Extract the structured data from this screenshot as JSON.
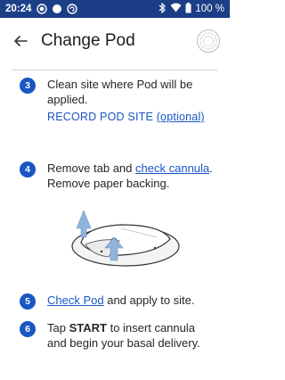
{
  "status_bar": {
    "time": "20:24",
    "battery": "100 %"
  },
  "header": {
    "title": "Change Pod"
  },
  "steps": [
    {
      "number": "3",
      "text": "Clean site where Pod will be applied.",
      "record_label": "RECORD POD SITE",
      "record_optional": "(optional)"
    },
    {
      "number": "4",
      "text_before": "Remove tab and",
      "link": "check cannula",
      "text_after": ". Remove paper backing."
    },
    {
      "number": "5",
      "link": "Check Pod",
      "text_after": "and apply to site."
    },
    {
      "number": "6",
      "text_before": "Tap",
      "bold": "START",
      "text_after": "to insert cannula and begin your basal delivery."
    }
  ],
  "colors": {
    "status_bar": "#1b3e86",
    "accent": "#1a56c4"
  }
}
